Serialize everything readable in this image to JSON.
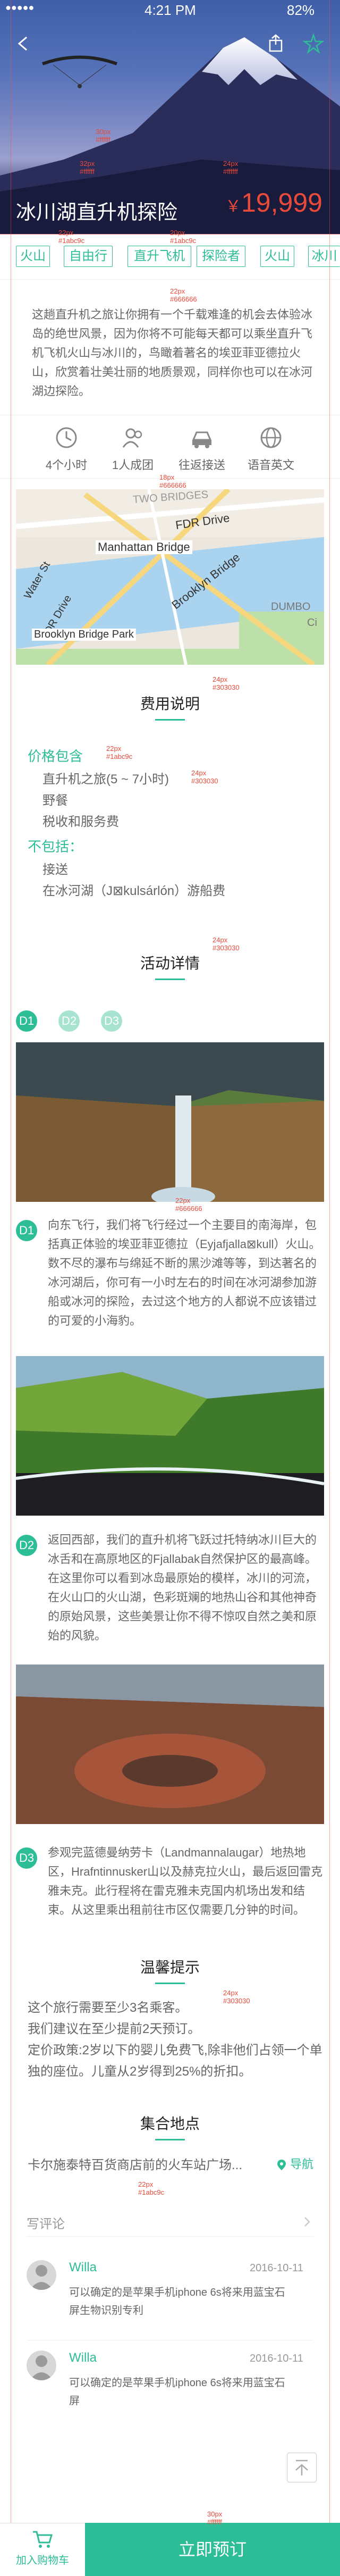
{
  "status_bar": {
    "signal": "●●●●● ",
    "time": "4:21 PM",
    "battery": "82%"
  },
  "hero": {
    "title": "冰川湖直升机探险",
    "price_symbol": "￥",
    "price": "19,999"
  },
  "tags": [
    "火山",
    "自由行",
    "直升飞机",
    "探险者",
    "火山",
    "冰川"
  ],
  "description": "这趟直升机之旅让你拥有一个千载难逢的机会去体验冰岛的绝世风景，因为你将不可能每天都可以乘坐直升飞机飞机火山与冰川的，鸟瞰着著名的埃亚菲亚德拉火山，欣赏着壮美壮丽的地质景观，同样你也可以在冰河湖边探险。",
  "features": [
    {
      "icon": "clock-icon",
      "label": "4个小时"
    },
    {
      "icon": "group-icon",
      "label": "1人成团"
    },
    {
      "icon": "car-icon",
      "label": "往返接送"
    },
    {
      "icon": "globe-icon",
      "label": "语音英文"
    }
  ],
  "map": {
    "labels": [
      "TWO BRIDGES",
      "FDR Drive",
      "Manhattan Bridge",
      "Brooklyn Bridge",
      "Water St",
      "FDR Drive",
      "DUMBO",
      "Brooklyn Bridge Park",
      "Ci"
    ]
  },
  "fee": {
    "title": "费用说明",
    "included_label": "价格包含",
    "included": [
      "直升机之旅(5 ~ 7小时)",
      "野餐",
      "税收和服务费"
    ],
    "excluded_label": "不包括：",
    "excluded": [
      "接送",
      "在冰河湖（J⊠kulsárlón）游船费"
    ]
  },
  "activity": {
    "title": "活动详情",
    "tabs": [
      "D1",
      "D2",
      "D3"
    ],
    "days": [
      {
        "day": "D1",
        "text": "向东飞行，我们将飞行经过一个主要目的南海岸，包括真正体验的埃亚菲亚德拉（Eyjafjalla⊠kull）火山。数不尽的瀑布与绵延不断的黑沙滩等等，到达著名的冰河湖后，你可有一小时左右的时间在冰河湖参加游船或冰河的探险，去过这个地方的人都说不应该错过的可爱的小海豹。"
      },
      {
        "day": "D2",
        "text": "返回西部，我们的直升机将飞跃过托特纳冰川巨大的冰舌和在高原地区的Fjallabak自然保护区的最高峰。在这里你可以看到冰岛最原始的模样，冰川的河流，在火山口的火山湖，色彩斑斓的地热山谷和其他神奇的原始风景，这些美景让你不得不惊叹自然之美和原始的风貌。"
      },
      {
        "day": "D3",
        "text": "参观完蓝德曼纳劳卡（Landmannalaugar）地热地区，Hrafntinnusker山以及赫克拉火山，最后返回雷克雅未克。此行程将在雷克雅未克国内机场出发和结束。从这里乘出租前往市区仅需要几分钟的时间。"
      }
    ]
  },
  "tips": {
    "title": "温馨提示",
    "lines": [
      "这个旅行需要至少3名乘客。",
      "我们建议在至少提前2天预订。",
      "定价政策:2岁以下的婴儿免费飞,除非他们占领一个单独的座位。儿童从2岁得到25%的折扣。"
    ]
  },
  "meeting": {
    "title": "集合地点",
    "address": "卡尔施泰特百货商店前的火车站广场...",
    "nav_label": "导航"
  },
  "reviews": {
    "title": "写评论",
    "items": [
      {
        "name": "Willa",
        "date": "2016-10-11",
        "text": "可以确定的是苹果手机iphone 6s将来用蓝宝石屏生物识别专利"
      },
      {
        "name": "Willa",
        "date": "2016-10-11",
        "text": "可以确定的是苹果手机iphone 6s将来用蓝宝石屏"
      }
    ]
  },
  "bottom": {
    "cart_label": "加入购物车",
    "book_label": "立即预订"
  },
  "annotations": [
    "32px\n#ffffff",
    "24px\n#ffffff",
    "30px\n#ffffff",
    "22px\n#1abc9c",
    "20px\n#1abc9c",
    "22px\n#666666",
    "18px\n#666666",
    "24px\n#303030",
    "22px\n#1abc9c",
    "24px\n#303030",
    "24px\n#303030",
    "22px\n#666666",
    "24px\n#303030",
    "22px\n#1abc9c",
    "30px\n#ffffff"
  ],
  "colors": {
    "accent": "#2dbd97",
    "price": "#e94a3a",
    "text": "#333333",
    "muted": "#666666"
  }
}
